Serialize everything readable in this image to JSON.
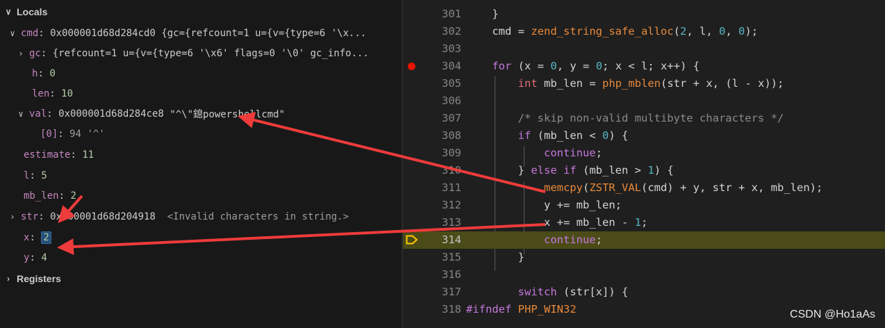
{
  "locals": {
    "header": "Locals",
    "registers": "Registers",
    "vars": {
      "cmd": {
        "name": "cmd",
        "value": "0x000001d68d284cd0 {gc={refcount=1 u={v={type=6 '\\x..."
      },
      "gc": {
        "name": "gc",
        "value": "{refcount=1 u={v={type=6 '\\x6' flags=0 '\\0' gc_info..."
      },
      "h": {
        "name": "h",
        "value": "0"
      },
      "len": {
        "name": "len",
        "value": "10"
      },
      "val": {
        "name": "val",
        "addr": "0x000001d68d284ce8",
        "str": "\"^\\\"鎴powershellcmd\""
      },
      "val0": {
        "name": "[0]",
        "value": "94",
        "char": "'^'"
      },
      "estimate": {
        "name": "estimate",
        "value": "11"
      },
      "l": {
        "name": "l",
        "value": "5"
      },
      "mb_len": {
        "name": "mb_len",
        "value": "2"
      },
      "str": {
        "name": "str",
        "addr": "0x000001d68d204918",
        "note": "<Invalid characters in string.>"
      },
      "x": {
        "name": "x",
        "value": "2"
      },
      "y": {
        "name": "y",
        "value": "4"
      }
    },
    "sep": ":"
  },
  "editor": {
    "lines": [
      {
        "no": "301",
        "tokens": [
          {
            "t": "    }",
            "c": "p-plain"
          }
        ]
      },
      {
        "no": "302",
        "tokens": [
          {
            "t": "    cmd ",
            "c": "p-plain"
          },
          {
            "t": "=",
            "c": "p-plain"
          },
          {
            "t": " zend_string_safe_alloc",
            "c": "p-fn"
          },
          {
            "t": "(",
            "c": "p-plain"
          },
          {
            "t": "2",
            "c": "p-num"
          },
          {
            "t": ", l, ",
            "c": "p-plain"
          },
          {
            "t": "0",
            "c": "p-num"
          },
          {
            "t": ", ",
            "c": "p-plain"
          },
          {
            "t": "0",
            "c": "p-num"
          },
          {
            "t": ");",
            "c": "p-plain"
          }
        ]
      },
      {
        "no": "303",
        "tokens": []
      },
      {
        "no": "304",
        "tokens": [
          {
            "t": "    ",
            "c": "p-plain"
          },
          {
            "t": "for",
            "c": "p-kw"
          },
          {
            "t": " (x ",
            "c": "p-plain"
          },
          {
            "t": "=",
            "c": "p-plain"
          },
          {
            "t": " ",
            "c": "p-plain"
          },
          {
            "t": "0",
            "c": "p-num"
          },
          {
            "t": ", y ",
            "c": "p-plain"
          },
          {
            "t": "=",
            "c": "p-plain"
          },
          {
            "t": " ",
            "c": "p-plain"
          },
          {
            "t": "0",
            "c": "p-num"
          },
          {
            "t": "; x ",
            "c": "p-plain"
          },
          {
            "t": "<",
            "c": "p-plain"
          },
          {
            "t": " l; x",
            "c": "p-plain"
          },
          {
            "t": "++",
            "c": "p-plain"
          },
          {
            "t": ") {",
            "c": "p-plain"
          }
        ]
      },
      {
        "no": "305",
        "tokens": [
          {
            "t": "        ",
            "c": "p-plain"
          },
          {
            "t": "int",
            "c": "p-type"
          },
          {
            "t": " mb_len ",
            "c": "p-plain"
          },
          {
            "t": "=",
            "c": "p-plain"
          },
          {
            "t": " ",
            "c": "p-plain"
          },
          {
            "t": "php_mblen",
            "c": "p-fn"
          },
          {
            "t": "(str ",
            "c": "p-plain"
          },
          {
            "t": "+",
            "c": "p-plain"
          },
          {
            "t": " x, (l ",
            "c": "p-plain"
          },
          {
            "t": "-",
            "c": "p-plain"
          },
          {
            "t": " x));",
            "c": "p-plain"
          }
        ]
      },
      {
        "no": "306",
        "tokens": []
      },
      {
        "no": "307",
        "tokens": [
          {
            "t": "        /* skip non-valid multibyte characters */",
            "c": "p-cm"
          }
        ]
      },
      {
        "no": "308",
        "tokens": [
          {
            "t": "        ",
            "c": "p-plain"
          },
          {
            "t": "if",
            "c": "p-kw"
          },
          {
            "t": " (mb_len ",
            "c": "p-plain"
          },
          {
            "t": "<",
            "c": "p-plain"
          },
          {
            "t": " ",
            "c": "p-plain"
          },
          {
            "t": "0",
            "c": "p-num"
          },
          {
            "t": ") {",
            "c": "p-plain"
          }
        ]
      },
      {
        "no": "309",
        "tokens": [
          {
            "t": "            ",
            "c": "p-plain"
          },
          {
            "t": "continue",
            "c": "p-kw"
          },
          {
            "t": ";",
            "c": "p-plain"
          }
        ]
      },
      {
        "no": "310",
        "tokens": [
          {
            "t": "        } ",
            "c": "p-plain"
          },
          {
            "t": "else",
            "c": "p-kw"
          },
          {
            "t": " ",
            "c": "p-plain"
          },
          {
            "t": "if",
            "c": "p-kw"
          },
          {
            "t": " (mb_len ",
            "c": "p-plain"
          },
          {
            "t": ">",
            "c": "p-plain"
          },
          {
            "t": " ",
            "c": "p-plain"
          },
          {
            "t": "1",
            "c": "p-num"
          },
          {
            "t": ") {",
            "c": "p-plain"
          }
        ]
      },
      {
        "no": "311",
        "tokens": [
          {
            "t": "            ",
            "c": "p-plain"
          },
          {
            "t": "memcpy",
            "c": "p-fn"
          },
          {
            "t": "(",
            "c": "p-plain"
          },
          {
            "t": "ZSTR_VAL",
            "c": "p-mac"
          },
          {
            "t": "(cmd) ",
            "c": "p-plain"
          },
          {
            "t": "+",
            "c": "p-plain"
          },
          {
            "t": " y, str ",
            "c": "p-plain"
          },
          {
            "t": "+",
            "c": "p-plain"
          },
          {
            "t": " x, mb_len);",
            "c": "p-plain"
          }
        ]
      },
      {
        "no": "312",
        "tokens": [
          {
            "t": "            y ",
            "c": "p-plain"
          },
          {
            "t": "+=",
            "c": "p-plain"
          },
          {
            "t": " mb_len;",
            "c": "p-plain"
          }
        ]
      },
      {
        "no": "313",
        "tokens": [
          {
            "t": "            x ",
            "c": "p-plain"
          },
          {
            "t": "+=",
            "c": "p-plain"
          },
          {
            "t": " mb_len ",
            "c": "p-plain"
          },
          {
            "t": "-",
            "c": "p-plain"
          },
          {
            "t": " ",
            "c": "p-plain"
          },
          {
            "t": "1",
            "c": "p-num"
          },
          {
            "t": ";",
            "c": "p-plain"
          }
        ]
      },
      {
        "no": "314",
        "tokens": [
          {
            "t": "            ",
            "c": "p-plain"
          },
          {
            "t": "continue",
            "c": "p-kw"
          },
          {
            "t": ";",
            "c": "p-plain"
          }
        ]
      },
      {
        "no": "315",
        "tokens": [
          {
            "t": "        }",
            "c": "p-plain"
          }
        ]
      },
      {
        "no": "316",
        "tokens": []
      },
      {
        "no": "317",
        "tokens": [
          {
            "t": "        ",
            "c": "p-plain"
          },
          {
            "t": "switch",
            "c": "p-kw"
          },
          {
            "t": " (str[x]) {",
            "c": "p-plain"
          }
        ]
      },
      {
        "no": "318",
        "tokens": [
          {
            "t": "#ifndef",
            "c": "p-kw"
          },
          {
            "t": " ",
            "c": "p-plain"
          },
          {
            "t": "PHP_WIN32",
            "c": "p-mac"
          }
        ]
      }
    ],
    "breakpoint_line": "304",
    "current_line": "314"
  },
  "watermark": "CSDN @Ho1aAs",
  "colors": {
    "annotation_arrow": "#ee3b3b",
    "breakpoint": "#e51400",
    "current_line_bg": "#4b4b18"
  }
}
